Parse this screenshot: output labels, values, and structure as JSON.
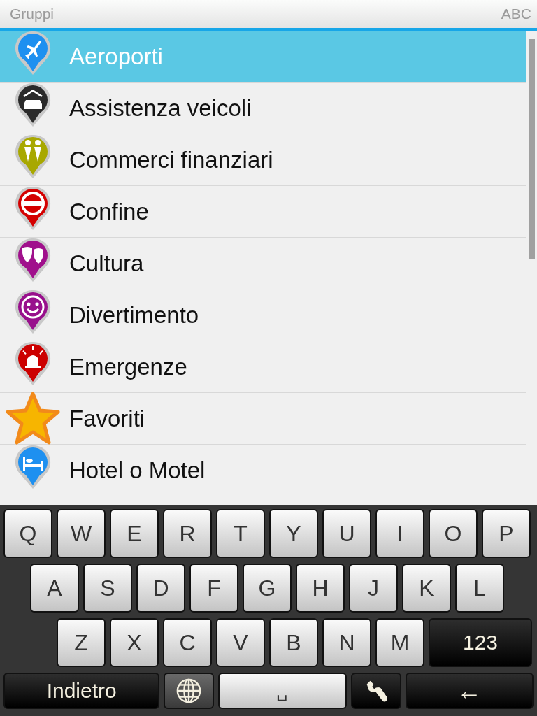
{
  "header": {
    "title": "Gruppi",
    "mode": "ABC"
  },
  "groups": [
    {
      "label": "Aeroporti",
      "kind": "plane",
      "color": "#1e90f0",
      "selected": true
    },
    {
      "label": "Assistenza veicoli",
      "kind": "car",
      "color": "#2a2a2a",
      "selected": false
    },
    {
      "label": "Commerci finanziari",
      "kind": "people",
      "color": "#a8a800",
      "selected": false
    },
    {
      "label": "Confine",
      "kind": "border",
      "color": "#d40000",
      "selected": false
    },
    {
      "label": "Cultura",
      "kind": "masks",
      "color": "#a0108c",
      "selected": false
    },
    {
      "label": "Divertimento",
      "kind": "smiley",
      "color": "#98108c",
      "selected": false
    },
    {
      "label": "Emergenze",
      "kind": "siren",
      "color": "#cc0000",
      "selected": false
    },
    {
      "label": "Favoriti",
      "kind": "star",
      "color": "#f7b500",
      "selected": false
    },
    {
      "label": "Hotel o Motel",
      "kind": "bed",
      "color": "#1e90f0",
      "selected": false
    }
  ],
  "keyboard": [
    [
      {
        "label": "Q",
        "kind": "letter"
      },
      {
        "label": "W",
        "kind": "letter"
      },
      {
        "label": "E",
        "kind": "letter"
      },
      {
        "label": "R",
        "kind": "letter"
      },
      {
        "label": "T",
        "kind": "letter"
      },
      {
        "label": "Y",
        "kind": "letter"
      },
      {
        "label": "U",
        "kind": "letter"
      },
      {
        "label": "I",
        "kind": "letter"
      },
      {
        "label": "O",
        "kind": "letter"
      },
      {
        "label": "P",
        "kind": "letter"
      }
    ],
    [
      {
        "label": "A",
        "kind": "letter"
      },
      {
        "label": "S",
        "kind": "letter"
      },
      {
        "label": "D",
        "kind": "letter"
      },
      {
        "label": "F",
        "kind": "letter"
      },
      {
        "label": "G",
        "kind": "letter"
      },
      {
        "label": "H",
        "kind": "letter"
      },
      {
        "label": "J",
        "kind": "letter"
      },
      {
        "label": "K",
        "kind": "letter"
      },
      {
        "label": "L",
        "kind": "letter"
      }
    ],
    [
      {
        "label": "Z",
        "kind": "letter"
      },
      {
        "label": "X",
        "kind": "letter"
      },
      {
        "label": "C",
        "kind": "letter"
      },
      {
        "label": "V",
        "kind": "letter"
      },
      {
        "label": "B",
        "kind": "letter"
      },
      {
        "label": "N",
        "kind": "letter"
      },
      {
        "label": "M",
        "kind": "letter"
      },
      {
        "label": "123",
        "kind": "numbers"
      }
    ],
    [
      {
        "label": "Indietro",
        "kind": "back"
      },
      {
        "kind": "globe"
      },
      {
        "label": "␣",
        "kind": "space"
      },
      {
        "kind": "wrench"
      },
      {
        "label": "←",
        "kind": "backspace"
      }
    ]
  ]
}
